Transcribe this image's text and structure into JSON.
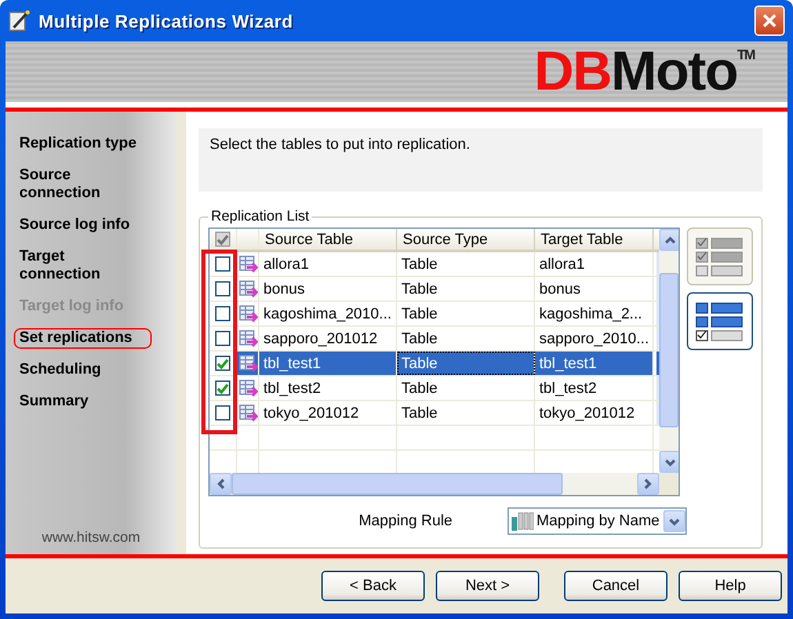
{
  "window": {
    "title": "Multiple Replications Wizard"
  },
  "banner": {
    "logo_accent": "DB",
    "logo_rest": "Moto",
    "trademark": "TM"
  },
  "sidebar": {
    "items": [
      {
        "label": "Replication type",
        "selected": false,
        "disabled": false
      },
      {
        "label": "Source connection",
        "selected": false,
        "disabled": false
      },
      {
        "label": "Source log info",
        "selected": false,
        "disabled": false
      },
      {
        "label": "Target connection",
        "selected": false,
        "disabled": false
      },
      {
        "label": "Target log info",
        "selected": false,
        "disabled": true
      },
      {
        "label": "Set replications",
        "selected": true,
        "disabled": false
      },
      {
        "label": "Scheduling",
        "selected": false,
        "disabled": false
      },
      {
        "label": "Summary",
        "selected": false,
        "disabled": false
      }
    ],
    "footer": "www.hitsw.com"
  },
  "instruction": "Select the tables to put into replication.",
  "replication_list": {
    "title": "Replication List",
    "header_checked": true,
    "columns": [
      "Source Table",
      "Source Type",
      "Target Table"
    ],
    "rows": [
      {
        "checked": false,
        "selected": false,
        "cells": [
          "allora1",
          "Table",
          "allora1"
        ]
      },
      {
        "checked": false,
        "selected": false,
        "cells": [
          "bonus",
          "Table",
          "bonus"
        ]
      },
      {
        "checked": false,
        "selected": false,
        "cells": [
          "kagoshima_2010...",
          "Table",
          "kagoshima_2..."
        ]
      },
      {
        "checked": false,
        "selected": false,
        "cells": [
          "sapporo_201012",
          "Table",
          "sapporo_2010..."
        ]
      },
      {
        "checked": true,
        "selected": true,
        "cells": [
          "tbl_test1",
          "Table",
          "tbl_test1"
        ]
      },
      {
        "checked": true,
        "selected": false,
        "cells": [
          "tbl_test2",
          "Table",
          "tbl_test2"
        ]
      },
      {
        "checked": false,
        "selected": false,
        "cells": [
          "tokyo_201012",
          "Table",
          "tokyo_201012"
        ]
      }
    ],
    "view_buttons": [
      {
        "kind": "checked-list",
        "selected": false
      },
      {
        "kind": "selected-list",
        "selected": true
      }
    ]
  },
  "mapping_rule": {
    "label": "Mapping Rule",
    "value": "Mapping by Name"
  },
  "buttons": [
    {
      "label": "< Back"
    },
    {
      "label": "Next >"
    },
    {
      "label": "Cancel"
    },
    {
      "label": "Help"
    }
  ]
}
